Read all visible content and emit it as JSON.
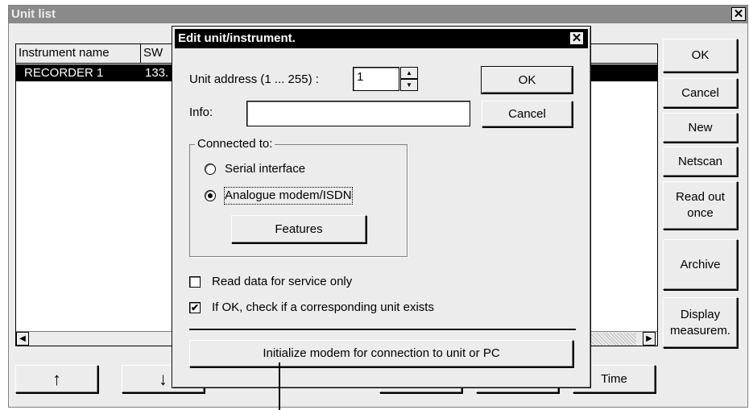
{
  "unit_list": {
    "title": "Unit list",
    "close_glyph": "✕",
    "columns": [
      "Instrument name",
      "SW"
    ],
    "rows": [
      {
        "name": "RECORDER 1",
        "sw": "133."
      }
    ],
    "buttons": {
      "ok": "OK",
      "cancel": "Cancel",
      "new": "New",
      "netscan": "Netscan",
      "read_out_once_line1": "Read out",
      "read_out_once_line2": "once",
      "archive": "Archive",
      "display_line1": "Display",
      "display_line2": "measurem.",
      "time": "Time"
    },
    "arrows": {
      "up": "↑",
      "down": "↓"
    }
  },
  "edit_dialog": {
    "title": "Edit unit/instrument.",
    "close_glyph": "✕",
    "unit_address_label": "Unit address (1 ... 255) :",
    "unit_address_value": "1",
    "info_label": "Info:",
    "info_value": "",
    "ok_label": "OK",
    "cancel_label": "Cancel",
    "connected_to_label": "Connected to:",
    "radio_serial": "Serial interface",
    "radio_modem": "Analogue modem/ISDN",
    "selected_connection": "Analogue modem/ISDN",
    "features_label": "Features",
    "checkbox_service": "Read data for service only",
    "checkbox_service_checked": false,
    "checkbox_verify": "If OK, check if a corresponding unit exists",
    "checkbox_verify_checked": true,
    "init_modem_label": "Initialize modem for connection to unit or PC"
  }
}
